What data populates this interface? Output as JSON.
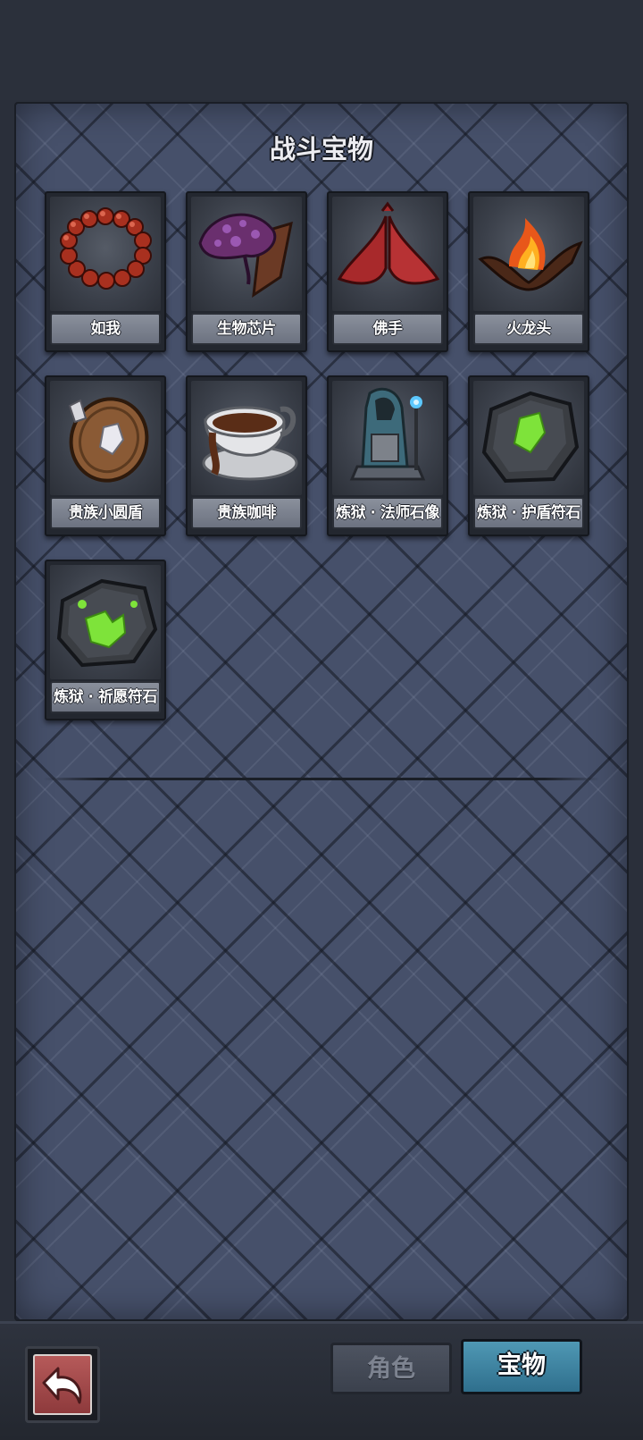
{
  "panel": {
    "title": "战斗宝物"
  },
  "items": [
    {
      "label": "如我",
      "icon": "prayer-beads-icon"
    },
    {
      "label": "生物芯片",
      "icon": "bio-chip-icon"
    },
    {
      "label": "佛手",
      "icon": "buddha-hand-icon"
    },
    {
      "label": "火龙头",
      "icon": "fire-dragon-head-icon"
    },
    {
      "label": "贵族小圆盾",
      "icon": "noble-round-shield-icon"
    },
    {
      "label": "贵族咖啡",
      "icon": "noble-coffee-icon"
    },
    {
      "label": "炼狱 · 法师石像",
      "icon": "mage-statue-icon"
    },
    {
      "label": "炼狱 · 护盾符石",
      "icon": "shield-rune-stone-icon"
    },
    {
      "label": "炼狱 · 祈愿符石",
      "icon": "wish-rune-stone-icon"
    }
  ],
  "tabs": {
    "role_label": "角色",
    "treasure_label": "宝物"
  },
  "back_button": {
    "icon": "return-arrow-icon"
  },
  "colors": {
    "panel": "#46506a",
    "active_tab": "#3f87a6",
    "rune_green": "#7ee33a"
  }
}
